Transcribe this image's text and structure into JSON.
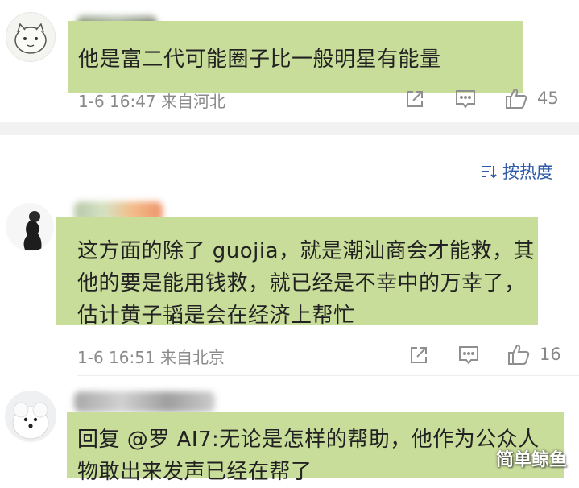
{
  "comments": [
    {
      "text_lines": [
        "他是富二代可能圈子比一般明星有能量"
      ],
      "time": "1-6 16:47",
      "location": "来自河北",
      "likes": "45"
    },
    {
      "text_lines": [
        "这方面的除了 guojia，就是潮汕商会才能救，其",
        "他的要是能用钱救，就已经是不幸中的万幸了，",
        "估计黄子韬是会在经济上帮忙"
      ],
      "time": "1-6 16:51",
      "location": "来自北京",
      "likes": "16"
    },
    {
      "text_lines": [
        "回复 @罗 AI7:无论是怎样的帮助，他作为公众人",
        "物敢出来发声已经在帮了"
      ]
    }
  ],
  "sort": {
    "label": "按热度"
  },
  "watermark": "简单鲸鱼",
  "colors": {
    "highlight": "#c9dd9a",
    "link": "#2f5aa8",
    "meta": "#8a8a8a"
  }
}
